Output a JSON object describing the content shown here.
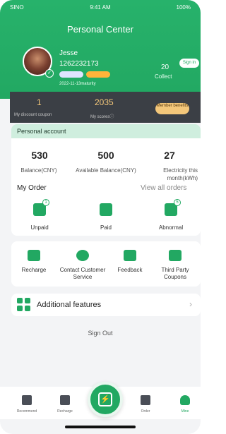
{
  "status_bar": {
    "carrier": "SINO",
    "time": "9:41 AM",
    "battery": "100%"
  },
  "header": {
    "title": "Personal Center"
  },
  "profile": {
    "name": "Jesse",
    "phone": "1262232173",
    "maturity": "2022-11-13maturity",
    "collect_count": "20",
    "collect_label": "Collect",
    "sign_in_label": "Sign in"
  },
  "rewards": {
    "coupon_count": "1",
    "coupon_label": "My discount coupon",
    "score_count": "2035",
    "score_label": "My scores",
    "member_benefits_label": "Member benefits"
  },
  "account": {
    "title": "Personal account",
    "stats": [
      {
        "value": "530",
        "label": "Balance(CNY)"
      },
      {
        "value": "500",
        "label": "Available Balance(CNY)"
      },
      {
        "value": "27",
        "label": "Electricity this month(kWh)"
      }
    ]
  },
  "orders": {
    "title": "My Order",
    "view_all_label": "View all orders",
    "items": [
      {
        "label": "Unpaid",
        "badge": "1",
        "icon": "wallet-icon"
      },
      {
        "label": "Paid",
        "icon": "clipboard-check-icon"
      },
      {
        "label": "Abnormal",
        "badge": "5",
        "icon": "abnormal-order-icon"
      }
    ]
  },
  "services": [
    {
      "label": "Recharge",
      "icon": "recharge-icon"
    },
    {
      "label": "Contact Customer Service",
      "icon": "customer-service-icon"
    },
    {
      "label": "Feedback",
      "icon": "feedback-icon"
    },
    {
      "label": "Third Party Coupons",
      "icon": "coupon-icon"
    }
  ],
  "features": {
    "label": "Additional features",
    "icon": "grid-icon"
  },
  "sign_out_label": "Sign Out",
  "tabbar": {
    "tabs": [
      {
        "label": "Recommend",
        "icon": "star-icon"
      },
      {
        "label": "Recharge",
        "icon": "recharge-tab-icon"
      },
      {
        "label": "Order",
        "icon": "order-icon"
      },
      {
        "label": "Mine",
        "icon": "person-icon"
      }
    ],
    "active_tab": "Mine"
  },
  "colors": {
    "primary": "#22a862",
    "dark_band": "#3b3f45",
    "gold": "#f3c77a",
    "light_green": "#cfeede"
  }
}
